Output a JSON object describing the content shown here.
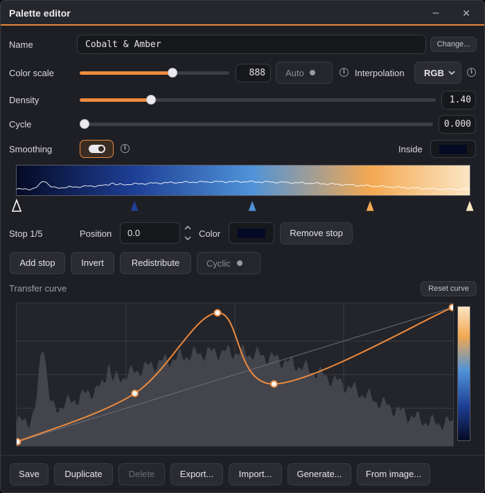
{
  "window": {
    "title": "Palette editor",
    "minimize_glyph": "–",
    "close_glyph": "✕"
  },
  "name_row": {
    "label": "Name",
    "value": "Cobalt & Amber",
    "change_label": "Change..."
  },
  "color_scale": {
    "label": "Color scale",
    "value": "888",
    "level": 0.62,
    "auto_label": "Auto"
  },
  "interpolation": {
    "label": "Interpolation",
    "value": "RGB"
  },
  "density": {
    "label": "Density",
    "value": "1.40",
    "level": 0.2
  },
  "cycle": {
    "label": "Cycle",
    "value": "0.000",
    "level": 0.0
  },
  "smoothing": {
    "label": "Smoothing",
    "inside_label": "Inside",
    "inside_color": "#050a24"
  },
  "stops_editor": {
    "stop_label": "Stop 1/5",
    "position_label": "Position",
    "position_value": "0.0",
    "color_label": "Color",
    "color_value": "#050a24",
    "remove_label": "Remove stop",
    "add_label": "Add stop",
    "invert_label": "Invert",
    "redistribute_label": "Redistribute",
    "cyclic_label": "Cyclic"
  },
  "palette_stops": [
    {
      "position": 0.0,
      "color": "#050a24"
    },
    {
      "position": 0.26,
      "color": "#1e3f96"
    },
    {
      "position": 0.52,
      "color": "#4f93d8"
    },
    {
      "position": 0.78,
      "color": "#f3a851"
    },
    {
      "position": 1.0,
      "color": "#fbe6c4"
    }
  ],
  "transfer": {
    "label": "Transfer curve",
    "reset_label": "Reset curve",
    "points": [
      [
        0.0,
        0.0
      ],
      [
        0.27,
        0.36
      ],
      [
        0.46,
        0.96
      ],
      [
        0.59,
        0.43
      ],
      [
        1.0,
        1.0
      ]
    ]
  },
  "actions": {
    "save": "Save",
    "duplicate": "Duplicate",
    "delete": "Delete",
    "export": "Export...",
    "import": "Import...",
    "generate": "Generate...",
    "from_image": "From image..."
  },
  "colors": {
    "accent": "#ef8b3e",
    "background": "#1e1f24",
    "panel": "#26272c"
  }
}
